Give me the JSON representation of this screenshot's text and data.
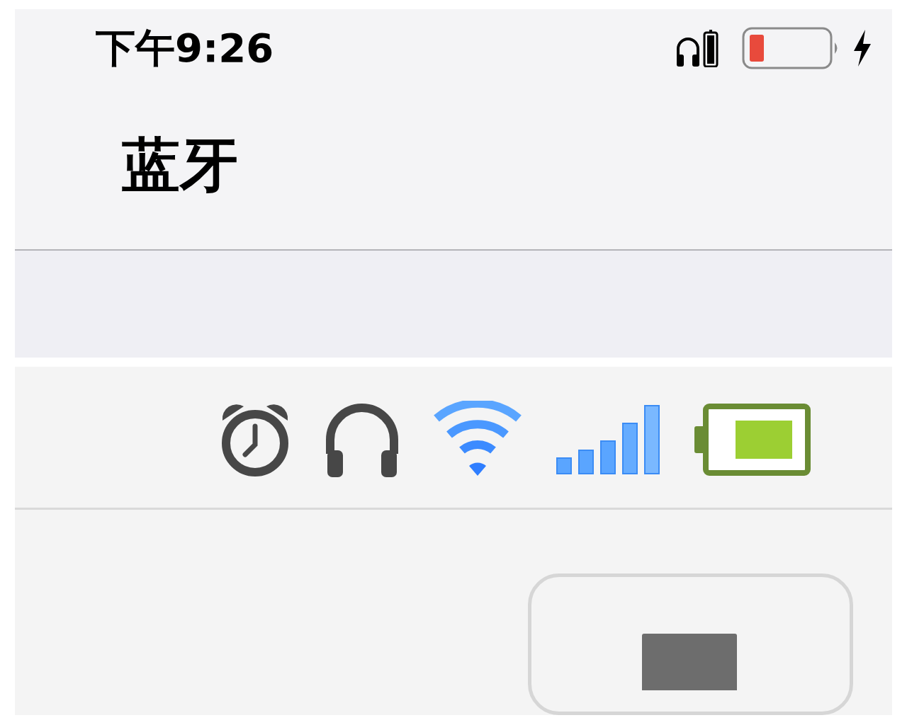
{
  "status_bar": {
    "time": "下午9:26"
  },
  "nav": {
    "title": "蓝牙"
  }
}
